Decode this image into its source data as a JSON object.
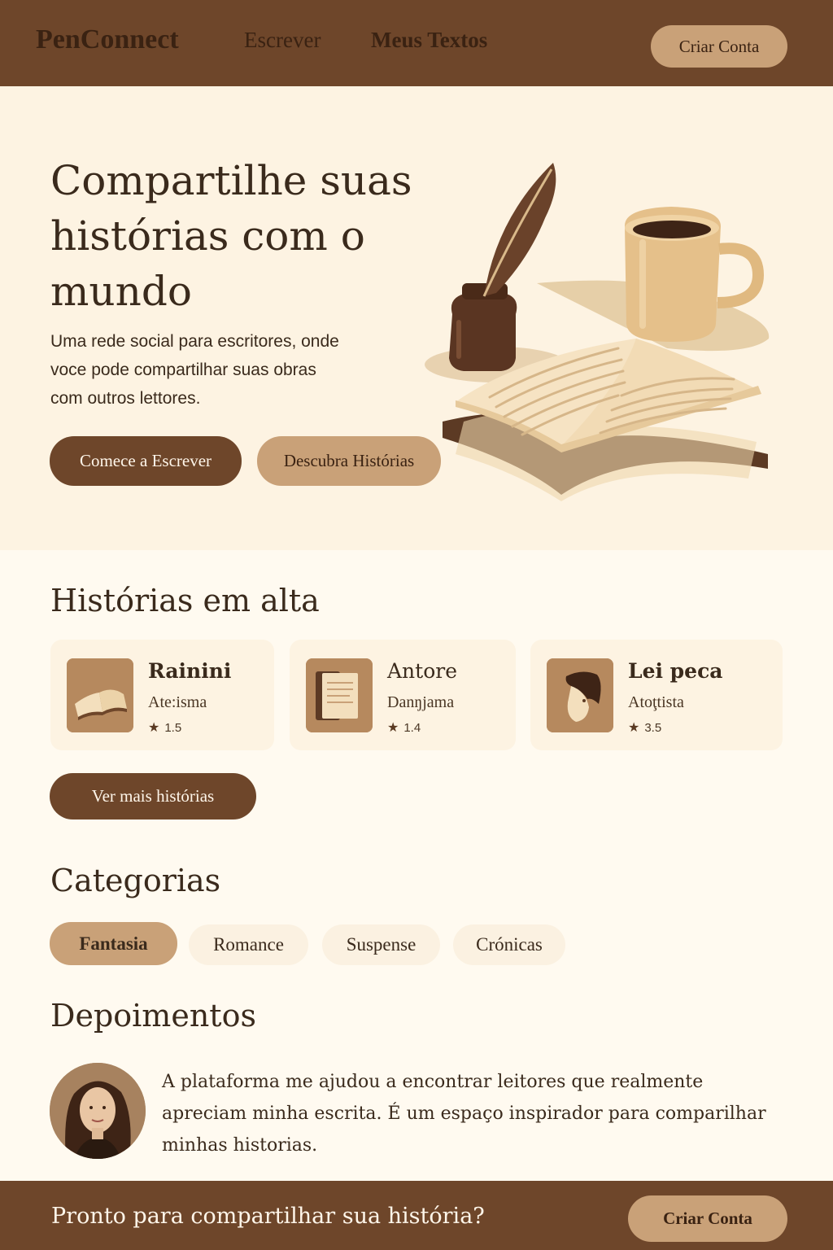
{
  "header": {
    "brand": "PenConnect",
    "nav": [
      "Escrever",
      "Meus Textos"
    ],
    "cta": "Criar Conta"
  },
  "hero": {
    "title": "Compartilhe suas histórias com o mundo",
    "subtitle": "Uma rede social para escritores, onde voce pode compartilhar suas obras com outros lettores.",
    "primary_button": "Comece a Escrever",
    "secondary_button": "Descubra Histórias"
  },
  "trending": {
    "title": "Histórias em alta",
    "stories": [
      {
        "title": "Rainini",
        "author": "Ate:isma",
        "rating": "1.5",
        "icon": "open-book-icon"
      },
      {
        "title": "Antore",
        "author": "Danŋjama",
        "rating": "1.4",
        "icon": "document-icon"
      },
      {
        "title": "Lei peca",
        "author": "Atoţtista",
        "rating": "3.5",
        "icon": "portrait-icon"
      }
    ],
    "more_button": "Ver mais histórias"
  },
  "categories": {
    "title": "Categorias",
    "items": [
      "Fantasia",
      "Romance",
      "Suspense",
      "Crónicas"
    ],
    "active": "Fantasia"
  },
  "testimonials": {
    "title": "Depoimentos",
    "quote": "A plataforma me ajudou a encontrar leitores que realmente apreciam minha escrita. É um espaço inspirador para comparilhar minhas historias."
  },
  "footer": {
    "text": "Pronto para compartilhar sua história?",
    "cta": "Criar Conta"
  },
  "colors": {
    "primary": "#6e462a",
    "accent": "#c9a178",
    "hero_bg": "#fdf3e2",
    "page_bg": "#fffaf0",
    "text": "#3a2a1c"
  }
}
